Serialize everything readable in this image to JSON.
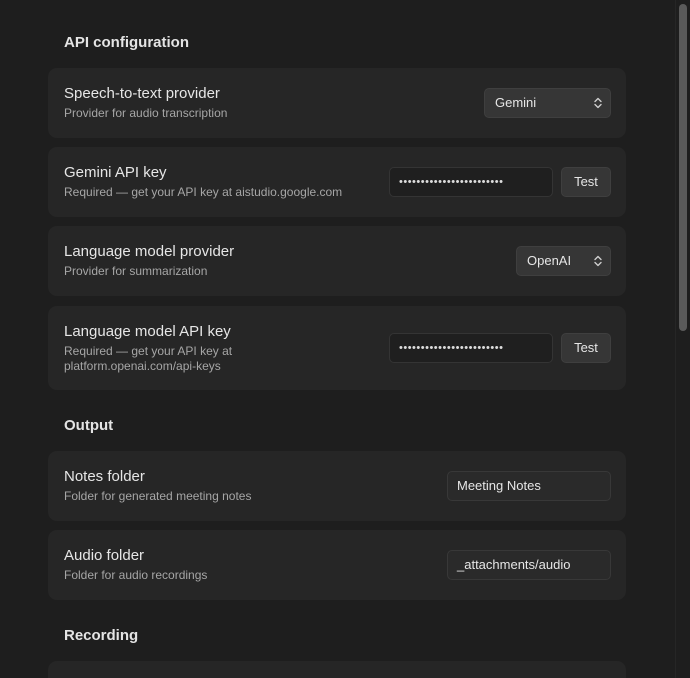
{
  "sections": {
    "api": {
      "title": "API configuration"
    },
    "output": {
      "title": "Output"
    },
    "recording": {
      "title": "Recording"
    }
  },
  "rows": {
    "stt_provider": {
      "title": "Speech-to-text provider",
      "desc": "Provider for audio transcription",
      "value": "Gemini"
    },
    "gemini_key": {
      "title": "Gemini API key",
      "desc": "Required — get your API key at aistudio.google.com",
      "value": "••••••••••••••••••••••••",
      "button": "Test"
    },
    "llm_provider": {
      "title": "Language model provider",
      "desc": "Provider for summarization",
      "value": "OpenAI"
    },
    "llm_key": {
      "title": "Language model API key",
      "desc": "Required — get your API key at platform.openai.com/api-keys",
      "value": "••••••••••••••••••••••••",
      "button": "Test"
    },
    "notes_folder": {
      "title": "Notes folder",
      "desc": "Folder for generated meeting notes",
      "value": "Meeting Notes"
    },
    "audio_folder": {
      "title": "Audio folder",
      "desc": "Folder for audio recordings",
      "value": "_attachments/audio"
    }
  },
  "icons": {
    "select_chevron": "chevron-up-down-icon"
  },
  "colors": {
    "background": "#1e1e1e",
    "row_background": "#262626",
    "control_background": "#363636"
  }
}
